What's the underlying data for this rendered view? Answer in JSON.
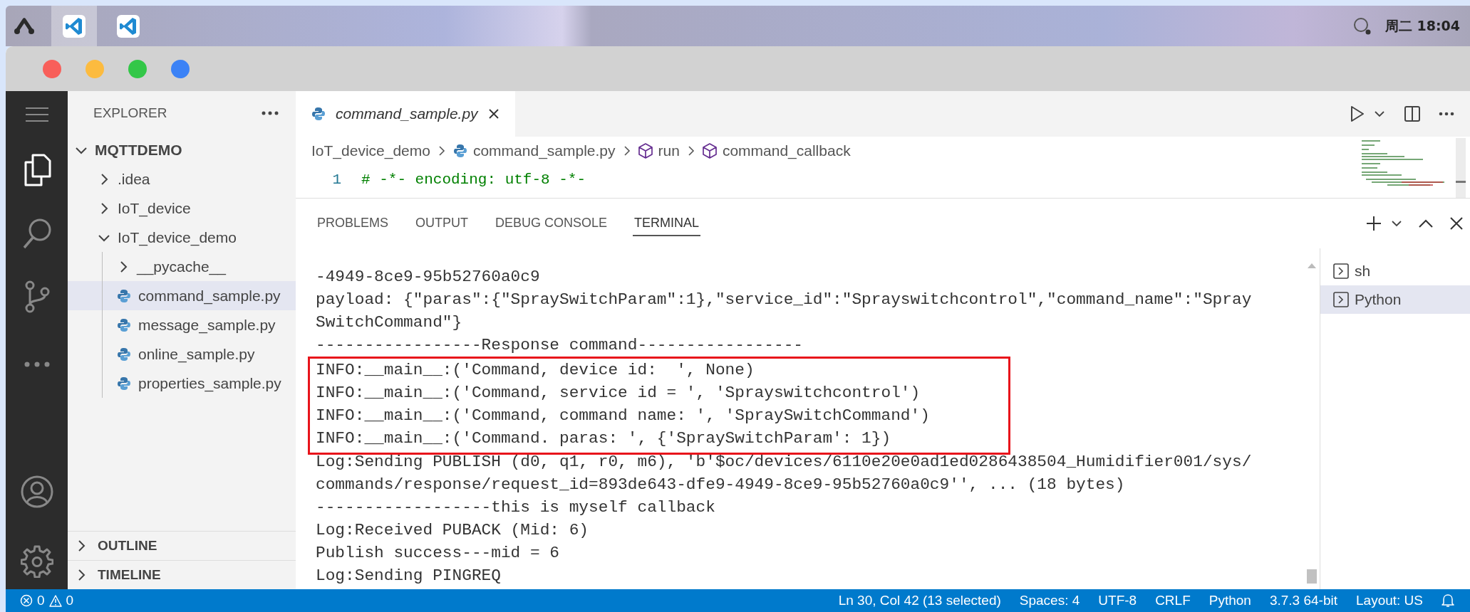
{
  "taskbar": {
    "apps": [
      {
        "kind": "launcher",
        "selected": false
      },
      {
        "kind": "vscode",
        "selected": true
      },
      {
        "kind": "vscode",
        "selected": false
      }
    ],
    "clock": "周二 18:04"
  },
  "window": {
    "controls": [
      {
        "color": "#f85f5a"
      },
      {
        "color": "#fcbb3f"
      },
      {
        "color": "#33c748"
      },
      {
        "color": "#3b82f6"
      }
    ]
  },
  "explorer": {
    "title": "EXPLORER",
    "tree": [
      {
        "label": "MQTTDEMO",
        "kind": "root",
        "expanded": true,
        "selected": false,
        "children": [
          {
            "label": ".idea",
            "kind": "folder",
            "expanded": false,
            "selected": false
          },
          {
            "label": "IoT_device",
            "kind": "folder",
            "expanded": false,
            "selected": false
          },
          {
            "label": "IoT_device_demo",
            "kind": "folder",
            "expanded": true,
            "selected": false,
            "children": [
              {
                "label": "__pycache__",
                "kind": "folder",
                "expanded": false,
                "selected": false
              },
              {
                "label": "command_sample.py",
                "kind": "python",
                "selected": true
              },
              {
                "label": "message_sample.py",
                "kind": "python",
                "selected": false
              },
              {
                "label": "online_sample.py",
                "kind": "python",
                "selected": false
              },
              {
                "label": "properties_sample.py",
                "kind": "python",
                "selected": false
              }
            ]
          }
        ]
      }
    ],
    "sections": [
      {
        "label": "OUTLINE",
        "expanded": false
      },
      {
        "label": "TIMELINE",
        "expanded": false
      }
    ]
  },
  "editor": {
    "tabs": [
      {
        "label": "command_sample.py",
        "selected": true
      }
    ],
    "breadcrumb": [
      {
        "label": "IoT_device_demo",
        "kind": "folder"
      },
      {
        "label": "command_sample.py",
        "kind": "python"
      },
      {
        "label": "run",
        "kind": "symbol"
      },
      {
        "label": "command_callback",
        "kind": "symbol"
      }
    ],
    "code": [
      {
        "number": "1",
        "text": "# -*- encoding: utf-8 -*-"
      }
    ]
  },
  "panel": {
    "tabs": [
      {
        "label": "PROBLEMS",
        "selected": false
      },
      {
        "label": "OUTPUT",
        "selected": false
      },
      {
        "label": "DEBUG CONSOLE",
        "selected": false
      },
      {
        "label": "TERMINAL",
        "selected": true
      }
    ],
    "terminal": {
      "blocks": [
        {
          "highlighted": false,
          "lines": [
            "-4949-8ce9-95b52760a0c9",
            "payload: {\"paras\":{\"SpraySwitchParam\":1},\"service_id\":\"Sprayswitchcontrol\",\"command_name\":\"Spray",
            "SwitchCommand\"}",
            "-----------------Response command-----------------"
          ]
        },
        {
          "highlighted": true,
          "lines": [
            "INFO:__main__:('Command, device id:  ', None)",
            "INFO:__main__:('Command, service id = ', 'Sprayswitchcontrol')",
            "INFO:__main__:('Command, command name: ', 'SpraySwitchCommand')",
            "INFO:__main__:('Command. paras: ', {'SpraySwitchParam': 1})"
          ]
        },
        {
          "highlighted": false,
          "lines": [
            "Log:Sending PUBLISH (d0, q1, r0, m6), 'b'$oc/devices/6110e20e0ad1ed0286438504_Humidifier001/sys/",
            "commands/response/request_id=893de643-dfe9-4949-8ce9-95b52760a0c9'', ... (18 bytes)",
            "------------------this is myself callback",
            "Log:Received PUBACK (Mid: 6)",
            "Publish success---mid = 6",
            "Log:Sending PINGREQ"
          ]
        }
      ]
    },
    "terminals": [
      {
        "label": "sh",
        "selected": false
      },
      {
        "label": "Python",
        "selected": true
      }
    ]
  },
  "status_bar": {
    "errors": "0",
    "warnings": "0",
    "items": [
      "Ln 30, Col 42 (13 selected)",
      "Spaces: 4",
      "UTF-8",
      "CRLF",
      "Python",
      "3.7.3 64-bit",
      "Layout: US"
    ]
  }
}
